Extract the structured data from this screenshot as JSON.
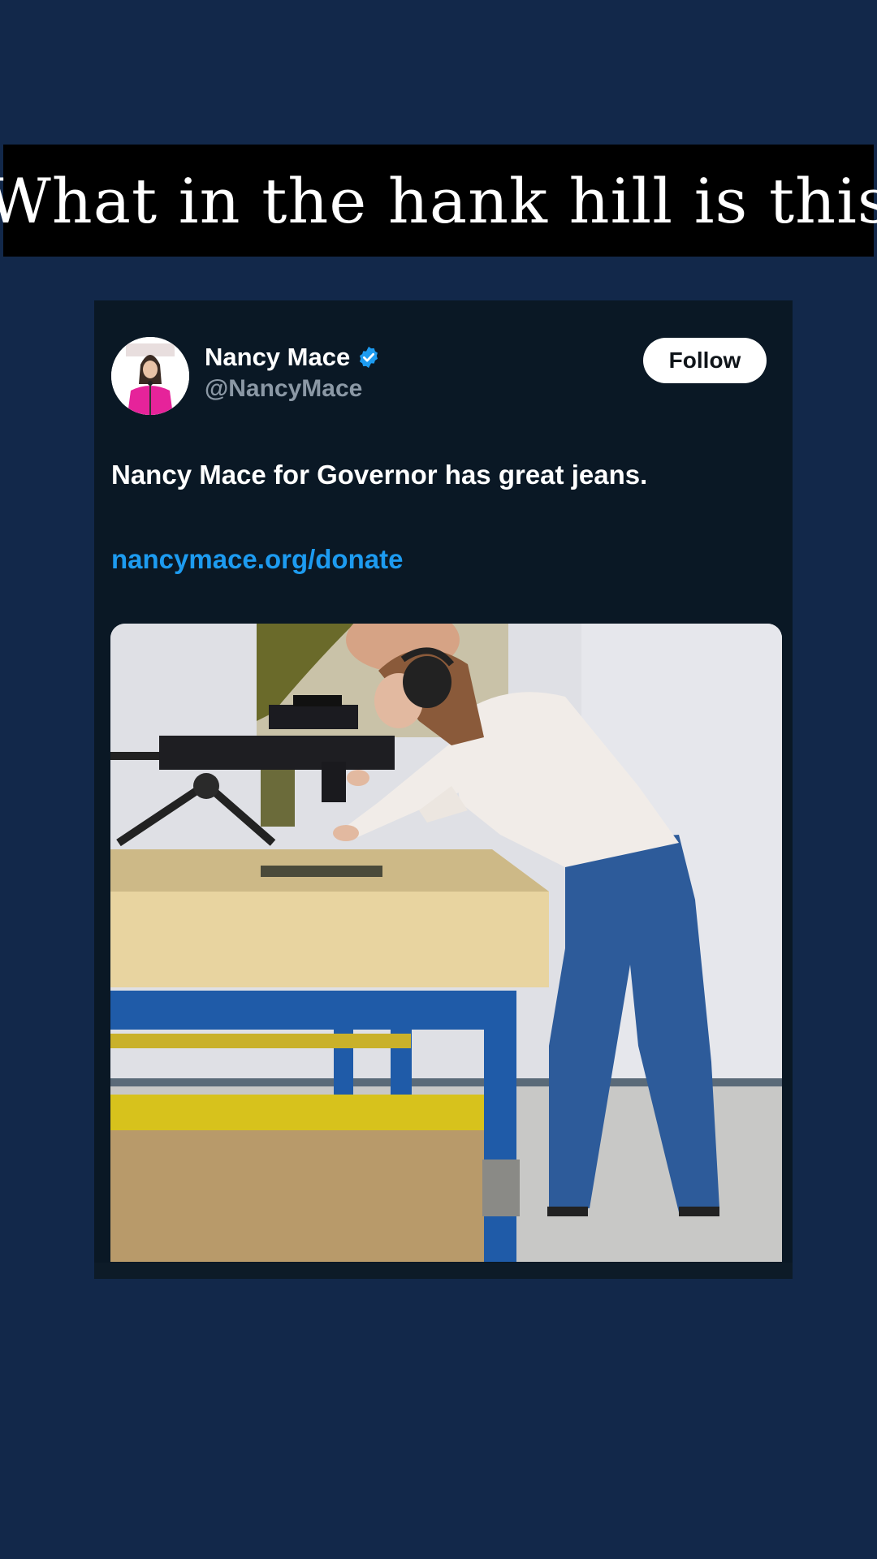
{
  "story": {
    "caption": "What in the hank hill is this",
    "background_color": "#12284a"
  },
  "tweet": {
    "author": {
      "display_name": "Nancy Mace",
      "handle": "@NancyMace",
      "verified": true,
      "avatar_icon": "profile-photo"
    },
    "follow_label": "Follow",
    "text": "Nancy Mace for Governor has great jeans.",
    "link": "nancymace.org/donate",
    "media_description_icon": "photo",
    "colors": {
      "card_background": "#0a1825",
      "link": "#1d9bf0",
      "verified": "#1d9bf0",
      "handle": "#8b98a5"
    }
  }
}
